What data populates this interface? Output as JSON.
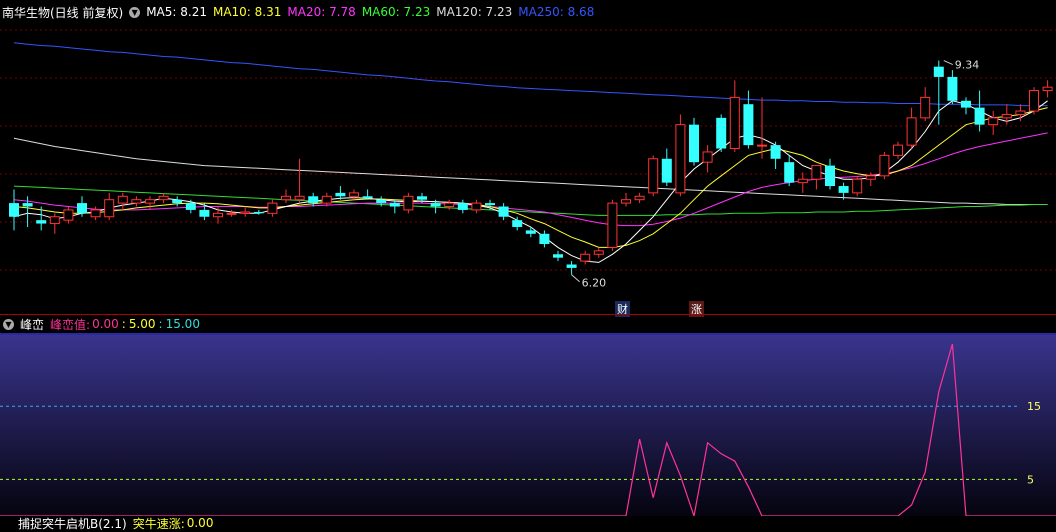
{
  "main_header": {
    "title": "南华生物(日线 前复权)",
    "ma": [
      {
        "label": "MA5: 8.21",
        "color": "#ffffff"
      },
      {
        "label": "MA10: 8.31",
        "color": "#ffff33"
      },
      {
        "label": "MA20: 7.78",
        "color": "#ff33ff"
      },
      {
        "label": "MA60: 7.23",
        "color": "#33ff33"
      },
      {
        "label": "MA120: 7.23",
        "color": "#dddddd"
      },
      {
        "label": "MA250: 8.68",
        "color": "#3355ff"
      }
    ]
  },
  "price_marks": {
    "high": "9.34",
    "low": "6.20"
  },
  "event_tags": [
    "财",
    "涨"
  ],
  "sub_header": {
    "title": "峰峦",
    "name": "峰峦值:",
    "v1": "0.00",
    "sep": ":",
    "v2": "5.00",
    "v3": "15.00"
  },
  "ref_lines": [
    "15",
    "5"
  ],
  "bottom_header": {
    "title": "捕捉突牛启机B(2.1)",
    "name": "突牛速涨:",
    "value": "0.00"
  },
  "chart_data": {
    "type": "candlestick",
    "ylim_price": [
      5.8,
      9.7
    ],
    "candles": [
      [
        7.25,
        7.45,
        6.85,
        7.05
      ],
      [
        7.25,
        7.35,
        6.9,
        7.2
      ],
      [
        7.0,
        7.2,
        6.85,
        6.95
      ],
      [
        6.95,
        7.1,
        6.8,
        7.05
      ],
      [
        7.0,
        7.2,
        6.95,
        7.15
      ],
      [
        7.25,
        7.35,
        7.05,
        7.1
      ],
      [
        7.05,
        7.2,
        7.0,
        7.15
      ],
      [
        7.05,
        7.4,
        7.0,
        7.3
      ],
      [
        7.25,
        7.4,
        7.15,
        7.35
      ],
      [
        7.25,
        7.35,
        7.2,
        7.3
      ],
      [
        7.25,
        7.35,
        7.15,
        7.3
      ],
      [
        7.3,
        7.4,
        7.25,
        7.35
      ],
      [
        7.3,
        7.35,
        7.2,
        7.25
      ],
      [
        7.25,
        7.3,
        7.1,
        7.15
      ],
      [
        7.15,
        7.25,
        7.0,
        7.05
      ],
      [
        7.05,
        7.2,
        6.95,
        7.1
      ],
      [
        7.1,
        7.15,
        7.05,
        7.1
      ],
      [
        7.1,
        7.2,
        7.05,
        7.12
      ],
      [
        7.12,
        7.15,
        7.08,
        7.1
      ],
      [
        7.1,
        7.3,
        7.05,
        7.25
      ],
      [
        7.3,
        7.45,
        7.25,
        7.35
      ],
      [
        7.3,
        7.9,
        7.25,
        7.35
      ],
      [
        7.35,
        7.4,
        7.2,
        7.25
      ],
      [
        7.25,
        7.4,
        7.2,
        7.35
      ],
      [
        7.4,
        7.5,
        7.3,
        7.35
      ],
      [
        7.35,
        7.45,
        7.3,
        7.4
      ],
      [
        7.35,
        7.45,
        7.3,
        7.32
      ],
      [
        7.3,
        7.35,
        7.2,
        7.25
      ],
      [
        7.25,
        7.3,
        7.1,
        7.2
      ],
      [
        7.15,
        7.4,
        7.1,
        7.35
      ],
      [
        7.35,
        7.4,
        7.25,
        7.3
      ],
      [
        7.25,
        7.3,
        7.1,
        7.2
      ],
      [
        7.2,
        7.3,
        7.15,
        7.25
      ],
      [
        7.25,
        7.3,
        7.1,
        7.15
      ],
      [
        7.15,
        7.3,
        7.1,
        7.25
      ],
      [
        7.25,
        7.3,
        7.15,
        7.22
      ],
      [
        7.2,
        7.25,
        7.0,
        7.05
      ],
      [
        7.0,
        7.05,
        6.85,
        6.9
      ],
      [
        6.85,
        6.9,
        6.75,
        6.8
      ],
      [
        6.8,
        6.85,
        6.6,
        6.65
      ],
      [
        6.5,
        6.55,
        6.4,
        6.45
      ],
      [
        6.35,
        6.4,
        6.2,
        6.3
      ],
      [
        6.4,
        6.55,
        6.35,
        6.5
      ],
      [
        6.5,
        6.6,
        6.45,
        6.55
      ],
      [
        6.6,
        7.3,
        6.55,
        7.25
      ],
      [
        7.25,
        7.4,
        7.2,
        7.3
      ],
      [
        7.3,
        7.4,
        7.25,
        7.35
      ],
      [
        7.4,
        7.95,
        7.35,
        7.9
      ],
      [
        7.9,
        8.05,
        7.5,
        7.55
      ],
      [
        7.4,
        8.55,
        7.35,
        8.4
      ],
      [
        8.4,
        8.5,
        7.8,
        7.85
      ],
      [
        7.85,
        8.1,
        7.7,
        8.0
      ],
      [
        8.5,
        8.55,
        8.0,
        8.05
      ],
      [
        8.05,
        9.05,
        8.0,
        8.8
      ],
      [
        8.7,
        8.9,
        8.05,
        8.1
      ],
      [
        8.1,
        8.8,
        7.9,
        8.1
      ],
      [
        8.1,
        8.15,
        7.75,
        7.9
      ],
      [
        7.85,
        7.95,
        7.5,
        7.55
      ],
      [
        7.55,
        7.7,
        7.4,
        7.6
      ],
      [
        7.6,
        7.8,
        7.45,
        7.8
      ],
      [
        7.8,
        7.9,
        7.45,
        7.5
      ],
      [
        7.5,
        7.55,
        7.3,
        7.4
      ],
      [
        7.4,
        7.65,
        7.35,
        7.6
      ],
      [
        7.6,
        7.7,
        7.5,
        7.65
      ],
      [
        7.65,
        8.0,
        7.6,
        7.95
      ],
      [
        7.95,
        8.15,
        7.9,
        8.1
      ],
      [
        8.1,
        8.65,
        8.05,
        8.5
      ],
      [
        8.5,
        8.95,
        8.45,
        8.8
      ],
      [
        9.25,
        9.34,
        8.4,
        9.1
      ],
      [
        9.1,
        9.2,
        8.7,
        8.75
      ],
      [
        8.75,
        8.8,
        8.55,
        8.65
      ],
      [
        8.65,
        8.9,
        8.3,
        8.4
      ],
      [
        8.4,
        8.6,
        8.25,
        8.5
      ],
      [
        8.5,
        8.7,
        8.4,
        8.55
      ],
      [
        8.55,
        8.7,
        8.45,
        8.6
      ],
      [
        8.6,
        8.95,
        8.55,
        8.9
      ],
      [
        8.9,
        9.05,
        8.8,
        8.95
      ]
    ],
    "ma5": [
      7.05,
      7.1,
      7.08,
      7.02,
      7.05,
      7.1,
      7.12,
      7.18,
      7.22,
      7.25,
      7.28,
      7.32,
      7.3,
      7.27,
      7.22,
      7.15,
      7.12,
      7.1,
      7.1,
      7.15,
      7.2,
      7.25,
      7.28,
      7.3,
      7.32,
      7.33,
      7.32,
      7.3,
      7.28,
      7.27,
      7.28,
      7.27,
      7.26,
      7.25,
      7.22,
      7.18,
      7.1,
      7.0,
      6.9,
      6.75,
      6.6,
      6.48,
      6.4,
      6.38,
      6.5,
      6.65,
      6.85,
      7.05,
      7.3,
      7.55,
      7.75,
      7.9,
      8.05,
      8.2,
      8.25,
      8.2,
      8.1,
      7.95,
      7.8,
      7.72,
      7.65,
      7.6,
      7.6,
      7.62,
      7.7,
      7.85,
      8.05,
      8.3,
      8.6,
      8.75,
      8.7,
      8.6,
      8.5,
      8.45,
      8.5,
      8.6,
      8.75
    ],
    "ma10": [
      7.2,
      7.18,
      7.15,
      7.12,
      7.1,
      7.1,
      7.11,
      7.13,
      7.15,
      7.18,
      7.2,
      7.22,
      7.24,
      7.25,
      7.25,
      7.24,
      7.22,
      7.2,
      7.18,
      7.18,
      7.2,
      7.22,
      7.24,
      7.26,
      7.28,
      7.3,
      7.31,
      7.31,
      7.3,
      7.29,
      7.28,
      7.27,
      7.26,
      7.25,
      7.23,
      7.2,
      7.15,
      7.1,
      7.02,
      6.95,
      6.85,
      6.75,
      6.68,
      6.6,
      6.6,
      6.63,
      6.7,
      6.8,
      6.95,
      7.1,
      7.3,
      7.5,
      7.65,
      7.8,
      7.95,
      8.0,
      8.05,
      8.0,
      7.95,
      7.85,
      7.78,
      7.72,
      7.68,
      7.65,
      7.66,
      7.72,
      7.8,
      7.95,
      8.1,
      8.25,
      8.4,
      8.45,
      8.5,
      8.52,
      8.55,
      8.6,
      8.65
    ],
    "ma20": [
      7.3,
      7.28,
      7.25,
      7.22,
      7.2,
      7.18,
      7.16,
      7.15,
      7.15,
      7.15,
      7.16,
      7.17,
      7.18,
      7.19,
      7.2,
      7.2,
      7.2,
      7.2,
      7.19,
      7.19,
      7.2,
      7.2,
      7.21,
      7.22,
      7.23,
      7.24,
      7.25,
      7.25,
      7.25,
      7.25,
      7.25,
      7.24,
      7.24,
      7.23,
      7.22,
      7.2,
      7.18,
      7.16,
      7.14,
      7.12,
      7.08,
      7.04,
      7.0,
      6.96,
      6.93,
      6.92,
      6.92,
      6.94,
      6.98,
      7.03,
      7.1,
      7.18,
      7.26,
      7.34,
      7.42,
      7.48,
      7.52,
      7.55,
      7.58,
      7.6,
      7.62,
      7.63,
      7.64,
      7.66,
      7.68,
      7.72,
      7.77,
      7.83,
      7.9,
      7.97,
      8.03,
      8.08,
      8.12,
      8.16,
      8.2,
      8.24,
      8.28
    ],
    "ma60": [
      7.5,
      7.49,
      7.48,
      7.47,
      7.46,
      7.45,
      7.44,
      7.43,
      7.42,
      7.41,
      7.4,
      7.39,
      7.38,
      7.37,
      7.36,
      7.35,
      7.34,
      7.33,
      7.32,
      7.31,
      7.3,
      7.29,
      7.28,
      7.27,
      7.26,
      7.25,
      7.24,
      7.23,
      7.22,
      7.21,
      7.2,
      7.19,
      7.18,
      7.17,
      7.16,
      7.15,
      7.14,
      7.13,
      7.12,
      7.11,
      7.1,
      7.09,
      7.08,
      7.07,
      7.07,
      7.07,
      7.07,
      7.07,
      7.08,
      7.08,
      7.08,
      7.09,
      7.09,
      7.1,
      7.1,
      7.1,
      7.11,
      7.11,
      7.11,
      7.12,
      7.12,
      7.12,
      7.13,
      7.13,
      7.14,
      7.15,
      7.16,
      7.17,
      7.18,
      7.19,
      7.2,
      7.2,
      7.21,
      7.22,
      7.22,
      7.23,
      7.23
    ],
    "ma120": [
      8.2,
      8.16,
      8.12,
      8.08,
      8.05,
      8.02,
      7.99,
      7.96,
      7.93,
      7.9,
      7.88,
      7.86,
      7.84,
      7.82,
      7.8,
      7.79,
      7.78,
      7.77,
      7.76,
      7.75,
      7.74,
      7.73,
      7.72,
      7.71,
      7.7,
      7.69,
      7.68,
      7.67,
      7.66,
      7.65,
      7.64,
      7.63,
      7.62,
      7.61,
      7.6,
      7.59,
      7.58,
      7.57,
      7.56,
      7.55,
      7.54,
      7.53,
      7.52,
      7.51,
      7.5,
      7.49,
      7.48,
      7.47,
      7.46,
      7.45,
      7.44,
      7.43,
      7.42,
      7.41,
      7.4,
      7.39,
      7.38,
      7.37,
      7.36,
      7.35,
      7.34,
      7.33,
      7.32,
      7.31,
      7.3,
      7.29,
      7.28,
      7.27,
      7.26,
      7.25,
      7.25,
      7.24,
      7.24,
      7.23,
      7.23,
      7.23,
      7.23
    ],
    "ma250": [
      9.6,
      9.58,
      9.56,
      9.55,
      9.53,
      9.51,
      9.49,
      9.47,
      9.46,
      9.44,
      9.42,
      9.4,
      9.39,
      9.37,
      9.35,
      9.33,
      9.31,
      9.3,
      9.28,
      9.26,
      9.24,
      9.22,
      9.21,
      9.19,
      9.17,
      9.15,
      9.13,
      9.12,
      9.1,
      9.08,
      9.06,
      9.04,
      9.03,
      9.01,
      8.99,
      8.97,
      8.96,
      8.94,
      8.93,
      8.92,
      8.91,
      8.9,
      8.89,
      8.88,
      8.87,
      8.86,
      8.85,
      8.84,
      8.83,
      8.82,
      8.81,
      8.8,
      8.79,
      8.78,
      8.77,
      8.76,
      8.76,
      8.75,
      8.75,
      8.74,
      8.74,
      8.73,
      8.73,
      8.72,
      8.72,
      8.71,
      8.71,
      8.71,
      8.7,
      8.7,
      8.7,
      8.69,
      8.69,
      8.69,
      8.68,
      8.68,
      8.68
    ],
    "fengluan": [
      0,
      0,
      0,
      0,
      0,
      0,
      0,
      0,
      0,
      0,
      0,
      0,
      0,
      0,
      0,
      0,
      0,
      0,
      0,
      0,
      0,
      0,
      0,
      0,
      0,
      0,
      0,
      0,
      0,
      0,
      0,
      0,
      0,
      0,
      0,
      0,
      0,
      0,
      0,
      0,
      0,
      0,
      0,
      0,
      0,
      0,
      10.5,
      2.5,
      10,
      5.5,
      0,
      10,
      8.5,
      7.5,
      4,
      0,
      0,
      0,
      0,
      0,
      0,
      0,
      0,
      0,
      0,
      0,
      1.5,
      6,
      17,
      23.5,
      0,
      0,
      0,
      0,
      0,
      0,
      0
    ],
    "sub_ylim": [
      0,
      25
    ]
  }
}
